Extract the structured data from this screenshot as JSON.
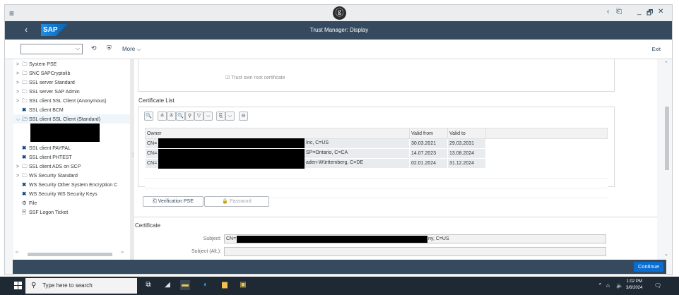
{
  "window": {
    "menu_icon": "≡",
    "logo_icon": "ⓖ",
    "controls": {
      "back": "‹",
      "restore_user": "⎗",
      "minimize": "_",
      "maximize": "🗗",
      "close": "✕"
    }
  },
  "shell": {
    "back_icon": "‹",
    "logo_text": "SAP",
    "title": "Trust Manager: Display"
  },
  "toolbar": {
    "combo_value": "",
    "combo_arrow": "⌵",
    "more_label": "More ⌵",
    "exit_label": "Exit"
  },
  "tree": {
    "items": [
      {
        "label": "System PSE",
        "expander": ">",
        "icon": "folder-icon"
      },
      {
        "label": "SNC SAPCryptolib",
        "expander": ">",
        "icon": "folder-icon"
      },
      {
        "label": "SSL server Standard",
        "expander": ">",
        "icon": "folder-icon"
      },
      {
        "label": "SSL server SAP Admin",
        "expander": ">",
        "icon": "folder-icon"
      },
      {
        "label": "SSL client SSL Client (Anonymous)",
        "expander": ">",
        "icon": "folder-icon"
      },
      {
        "label": "SSL client BCM",
        "expander": "",
        "icon": "x-icon"
      },
      {
        "label": "SSL client SSL Client (Standard)",
        "expander": "⌵",
        "icon": "folder-open-icon"
      },
      {
        "label": "SSL client PAYPAL",
        "expander": "",
        "icon": "x-icon"
      },
      {
        "label": "SSL client PHTEST",
        "expander": "",
        "icon": "x-icon"
      },
      {
        "label": "SSL client ADS on SCP",
        "expander": ">",
        "icon": "folder-icon"
      },
      {
        "label": "WS Security Standard",
        "expander": ">",
        "icon": "folder-icon"
      },
      {
        "label": "WS Security Other System Encryption C",
        "expander": "",
        "icon": "x-icon"
      },
      {
        "label": "WS Security WS Security Keys",
        "expander": "",
        "icon": "x-icon"
      },
      {
        "label": "File",
        "expander": "",
        "icon": "gear-icon"
      },
      {
        "label": "SSF Logon Ticket",
        "expander": "",
        "icon": "document-icon"
      }
    ]
  },
  "main": {
    "trust_root_label": "Trust own root certificate",
    "certificate_list_title": "Certificate List",
    "columns": [
      "Owner",
      "Valid from",
      "Valid to"
    ],
    "rows": [
      {
        "owner_prefix": "CN=",
        "owner_suffix": "Inc, C=US",
        "valid_from": "30.03.2021",
        "valid_to": "29.03.2031"
      },
      {
        "owner_prefix": "CN=",
        "owner_suffix": "SP=Ontario, C=CA",
        "valid_from": "14.07.2023",
        "valid_to": "13.08.2024"
      },
      {
        "owner_prefix": "CN=",
        "owner_suffix": "aden-Württemberg, C=DE",
        "valid_from": "02.01.2024",
        "valid_to": "31.12.2024"
      }
    ],
    "verification_button": "Verification PSE",
    "password_button": "Password",
    "certificate_title": "Certificate",
    "subject_label": "Subject:",
    "subject_prefix": "CN=",
    "subject_suffix": "ny, C=US",
    "subject_alt_label": "Subject (Alt.):",
    "subject_alt_value": ""
  },
  "footer": {
    "continue_label": "Continue"
  },
  "taskbar": {
    "search_placeholder": "Type here to search",
    "time": "1:02 PM",
    "date": "3/6/2024",
    "tray_chevron": "⌃",
    "notification_icon": "🗨"
  },
  "colors": {
    "shell_bar": "#354a5f",
    "primary_button": "#0a6ed1",
    "taskbar": "#1f2933"
  }
}
